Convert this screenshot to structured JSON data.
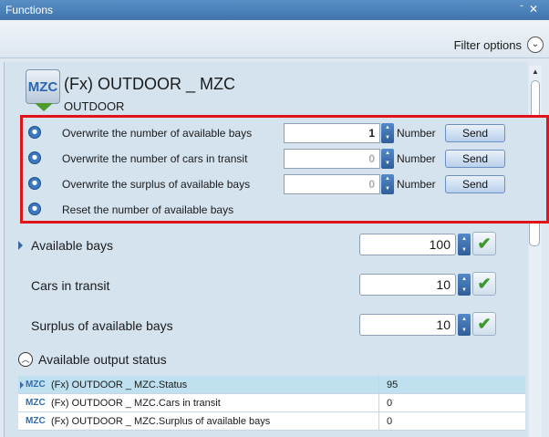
{
  "window": {
    "title": "Functions",
    "pin_icon": "pin-icon",
    "close_icon": "close-icon"
  },
  "filter": {
    "label": "Filter options",
    "icon": "chevron-down-icon"
  },
  "function": {
    "icon_text": "MZC",
    "title": "(Fx) OUTDOOR _ MZC",
    "subtitle": "OUTDOOR"
  },
  "commands": [
    {
      "label": "Overwrite the number of available bays",
      "value": "1",
      "unit": "Number",
      "send": "Send",
      "enabled": true
    },
    {
      "label": "Overwrite the number of cars in transit",
      "value": "0",
      "unit": "Number",
      "send": "Send",
      "enabled": false
    },
    {
      "label": "Overwrite the surplus of available bays",
      "value": "0",
      "unit": "Number",
      "send": "Send",
      "enabled": false
    },
    {
      "label": "Reset the number of available bays"
    }
  ],
  "values": [
    {
      "label": "Available bays",
      "value": "100"
    },
    {
      "label": "Cars in transit",
      "value": "10"
    },
    {
      "label": "Surplus of available bays",
      "value": "10"
    }
  ],
  "status": {
    "title": "Available output status",
    "rows": [
      {
        "tag": "MZC",
        "name": "(Fx) OUTDOOR _ MZC.Status",
        "value": "95",
        "selected": true
      },
      {
        "tag": "MZC",
        "name": "(Fx) OUTDOOR _ MZC.Cars in transit",
        "value": "0",
        "selected": false
      },
      {
        "tag": "MZC",
        "name": "(Fx) OUTDOOR _ MZC.Surplus of available bays",
        "value": "0",
        "selected": false
      }
    ]
  },
  "colors": {
    "highlight_border": "#e2141b",
    "title_bar": "#4a80bb",
    "check": "#3c9a2d"
  }
}
